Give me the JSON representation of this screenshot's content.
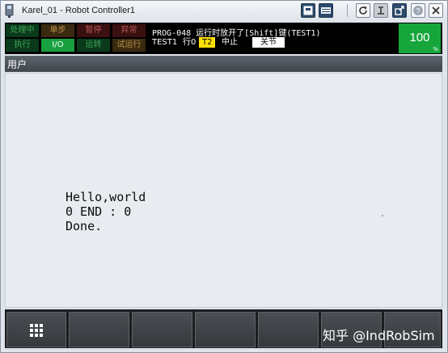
{
  "window": {
    "title": "Karel_01 - Robot Controller1"
  },
  "status": {
    "cells": [
      {
        "label": "处理中",
        "bg": "#0a3a1a",
        "fg": "#3fa35a"
      },
      {
        "label": "单步",
        "bg": "#3a2a10",
        "fg": "#b89048"
      },
      {
        "label": "暂停",
        "bg": "#3a1010",
        "fg": "#b85858"
      },
      {
        "label": "异常",
        "bg": "#3a1010",
        "fg": "#b85858"
      },
      {
        "label": "执行",
        "bg": "#0a3a1a",
        "fg": "#3fa35a"
      },
      {
        "label": "I/O",
        "bg": "#18a040",
        "fg": "#ffffff"
      },
      {
        "label": "运转",
        "bg": "#0a3a1a",
        "fg": "#3fa35a"
      },
      {
        "label": "试运行",
        "bg": "#3a2a10",
        "fg": "#b89048"
      }
    ],
    "message_line1": "PROG-048 运行时放开了[Shift]键(TEST1)",
    "program": "TEST1",
    "line_label": "行0",
    "mode": "T2",
    "state": "中止",
    "continuity": "关节",
    "speed_value": "100",
    "speed_unit": "%"
  },
  "menu": {
    "title": "用户"
  },
  "user_output": {
    "lines": [
      "Hello,world",
      "0 END : 0",
      "Done."
    ]
  },
  "function_keys": {
    "count": 7,
    "first_icon": "grid-menu-icon"
  },
  "watermark": "知乎 @IndRobSim",
  "colors": {
    "speed_box": "#17a63c",
    "mode_badge": "#ffe200",
    "menu_header": "#4a5058",
    "content_bg": "#e8ecf1"
  }
}
